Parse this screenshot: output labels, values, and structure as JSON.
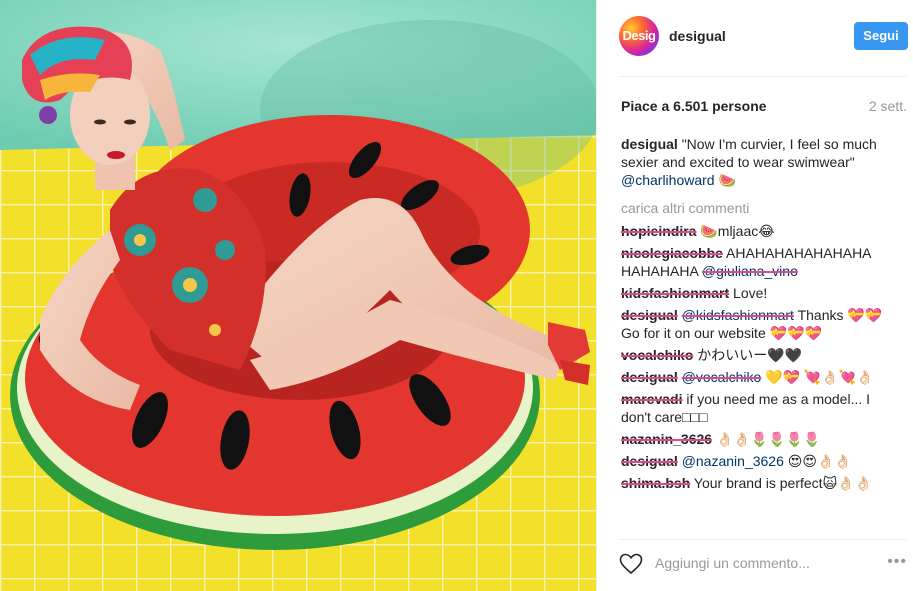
{
  "post": {
    "username": "desigual",
    "avatar_text": "Desig",
    "follow_label": "Segui",
    "likes": "Piace a 6.501 persone",
    "time": "2 sett.",
    "caption": {
      "user": "desigual",
      "text": "\"Now I'm curvier, I feel so much sexier and excited to wear swimwear\"",
      "mention": "@charlihoward",
      "emoji": "🍉"
    },
    "load_more": "carica altri commenti"
  },
  "comments": [
    {
      "user": "hopieindira",
      "text": "🍉mljaac😂"
    },
    {
      "user": "nicolegiacobbe",
      "text": "AHAHAHAHAHAHAHA HAHAHAHA",
      "mention": "@giuliana_vino"
    },
    {
      "user": "kidsfashionmart",
      "text": "Love!"
    },
    {
      "user": "desigual",
      "mention": "@kidsfashionmart",
      "text": "Thanks 💝💝 Go for it on our website 💝💝💝"
    },
    {
      "user": "vocalchiko",
      "text": "かわいいー🖤🖤"
    },
    {
      "user": "desigual",
      "mention": "@vocalchiko",
      "text": "💛💝 💘👌🏻💘👌🏻"
    },
    {
      "user": "marcvadi",
      "text": "if you need me as a model... I don't care□□□"
    },
    {
      "user": "nazanin_3626",
      "text": "👌🏻👌🏻🌷🌷🌷🌷"
    },
    {
      "user": "desigual",
      "mention": "@nazanin_3626",
      "text": "😍😍👌🏻👌🏻"
    },
    {
      "user": "shima.bsh",
      "text": "Your brand is perfect🙀👌🏻👌🏻"
    }
  ],
  "footer": {
    "add_comment_placeholder": "Aggiungi un commento...",
    "more_icon": "•••"
  },
  "colors": {
    "follow": "#3897f0",
    "pool_tile": "#f2df2a",
    "wall": "#8ad8c0",
    "watermelon_red": "#e2362f",
    "watermelon_green": "#2f9c3c"
  }
}
